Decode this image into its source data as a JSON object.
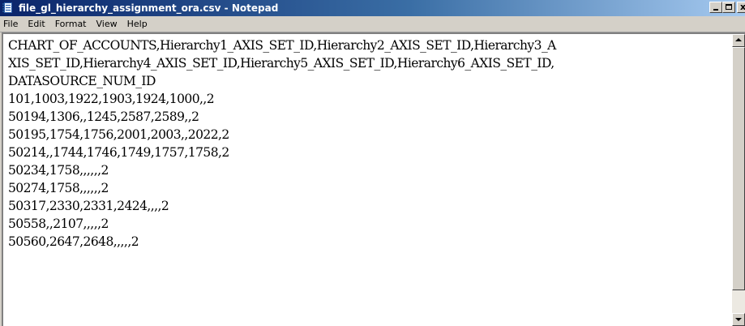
{
  "window": {
    "title": "file_gl_hierarchy_assignment_ora.csv - Notepad",
    "icon": "notepad-icon",
    "buttons": {
      "minimize_glyph": "_",
      "maximize_glyph": "□",
      "close_glyph": "x"
    }
  },
  "menu": {
    "items": [
      {
        "label": "File"
      },
      {
        "label": "Edit"
      },
      {
        "label": "Format"
      },
      {
        "label": "View"
      },
      {
        "label": "Help"
      }
    ]
  },
  "editor": {
    "lines": [
      "CHART_OF_ACCOUNTS,Hierarchy1_AXIS_SET_ID,Hierarchy2_AXIS_SET_ID,Hierarchy3_A",
      "XIS_SET_ID,Hierarchy4_AXIS_SET_ID,Hierarchy5_AXIS_SET_ID,Hierarchy6_AXIS_SET_ID,",
      "DATASOURCE_NUM_ID",
      "101,1003,1922,1903,1924,1000,,2",
      "50194,1306,,1245,2587,2589,,2",
      "50195,1754,1756,2001,2003,,2022,2",
      "50214,,1744,1746,1749,1757,1758,2",
      "50234,1758,,,,,,2",
      "50274,1758,,,,,,2",
      "50317,2330,2331,2424,,,,2",
      "50558,,2107,,,,,2",
      "50560,2647,2648,,,,,2"
    ]
  },
  "scrollbar": {
    "up_icon": "arrow-up-icon",
    "down_icon": "arrow-down-icon"
  },
  "colors": {
    "titlebar_start": "#0a246a",
    "titlebar_end": "#a6caf0",
    "chrome": "#d4d0c8"
  }
}
